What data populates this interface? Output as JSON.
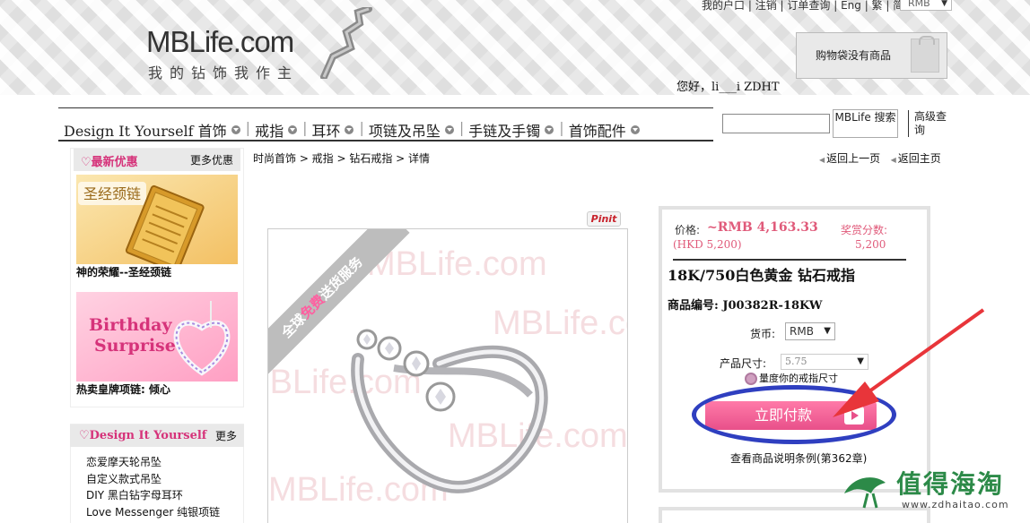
{
  "header": {
    "logo_text": "MBLife.com",
    "logo_tagline": "我的钻饰我作主",
    "top_links": [
      "我的户口",
      "注销",
      "订单查询",
      "Eng",
      "繁",
      "简"
    ],
    "currency_top": "RMB",
    "cart_text": "购物袋没有商品",
    "greeting": "您好，li___i ZDHT"
  },
  "nav": {
    "items": [
      "Design It Yourself 首饰",
      "戒指",
      "耳环",
      "项链及吊坠",
      "手链及手镯",
      "首饰配件"
    ],
    "search_button": "MBLife 搜索",
    "advanced_search": "高级查询"
  },
  "sidebar": {
    "promo_title": "最新优惠",
    "promo_more": "更多优惠",
    "promo1_banner": "圣经颈链",
    "promo1_caption": "神的荣耀--圣经颈链",
    "promo2_banner_line1": "Birthday",
    "promo2_banner_line2": "Surprise",
    "promo2_caption": "热卖皇牌项链: 倾心",
    "diy_title": "Design It Yourself",
    "diy_more": "更多",
    "diy_items": [
      "恋爱摩天轮吊坠",
      "自定义款式吊坠",
      "DIY 黑白钻字母耳环",
      "Love Messenger 纯银项链"
    ]
  },
  "breadcrumb": "时尚首饰 > 戒指 > 钻石戒指 > 详情",
  "back_links": [
    "返回上一页",
    "返回主页"
  ],
  "product": {
    "pinit": "Pinit",
    "watermark": "MBLife.com",
    "ribbon_pre": "全球",
    "ribbon_hl": "免费",
    "ribbon_post": "送货服务",
    "price_label": "价格:",
    "price": "~RMB 4,163.33",
    "price_hkd": "(HKD 5,200)",
    "points_label": "奖赏分数:",
    "points": "5,200",
    "title": "18K/750白色黄金 钻石戒指",
    "sku": "商品编号: J00382R-18KW",
    "currency_label": "货币:",
    "currency": "RMB",
    "size_label": "产品尺寸:",
    "size": "5.75",
    "measure_link": "量度你的戒指尺寸",
    "buy_button": "立即付款",
    "terms_link": "查看商品说明条例(第362章)"
  },
  "watermark_site": {
    "name": "值得海淘",
    "url": "www.zdhaitao.com"
  },
  "colors": {
    "accent_pink": "#e8508a",
    "price_pink": "#e05a7a",
    "annotation_blue": "#2f3fc0",
    "annotation_arrow": "#e8353a"
  }
}
